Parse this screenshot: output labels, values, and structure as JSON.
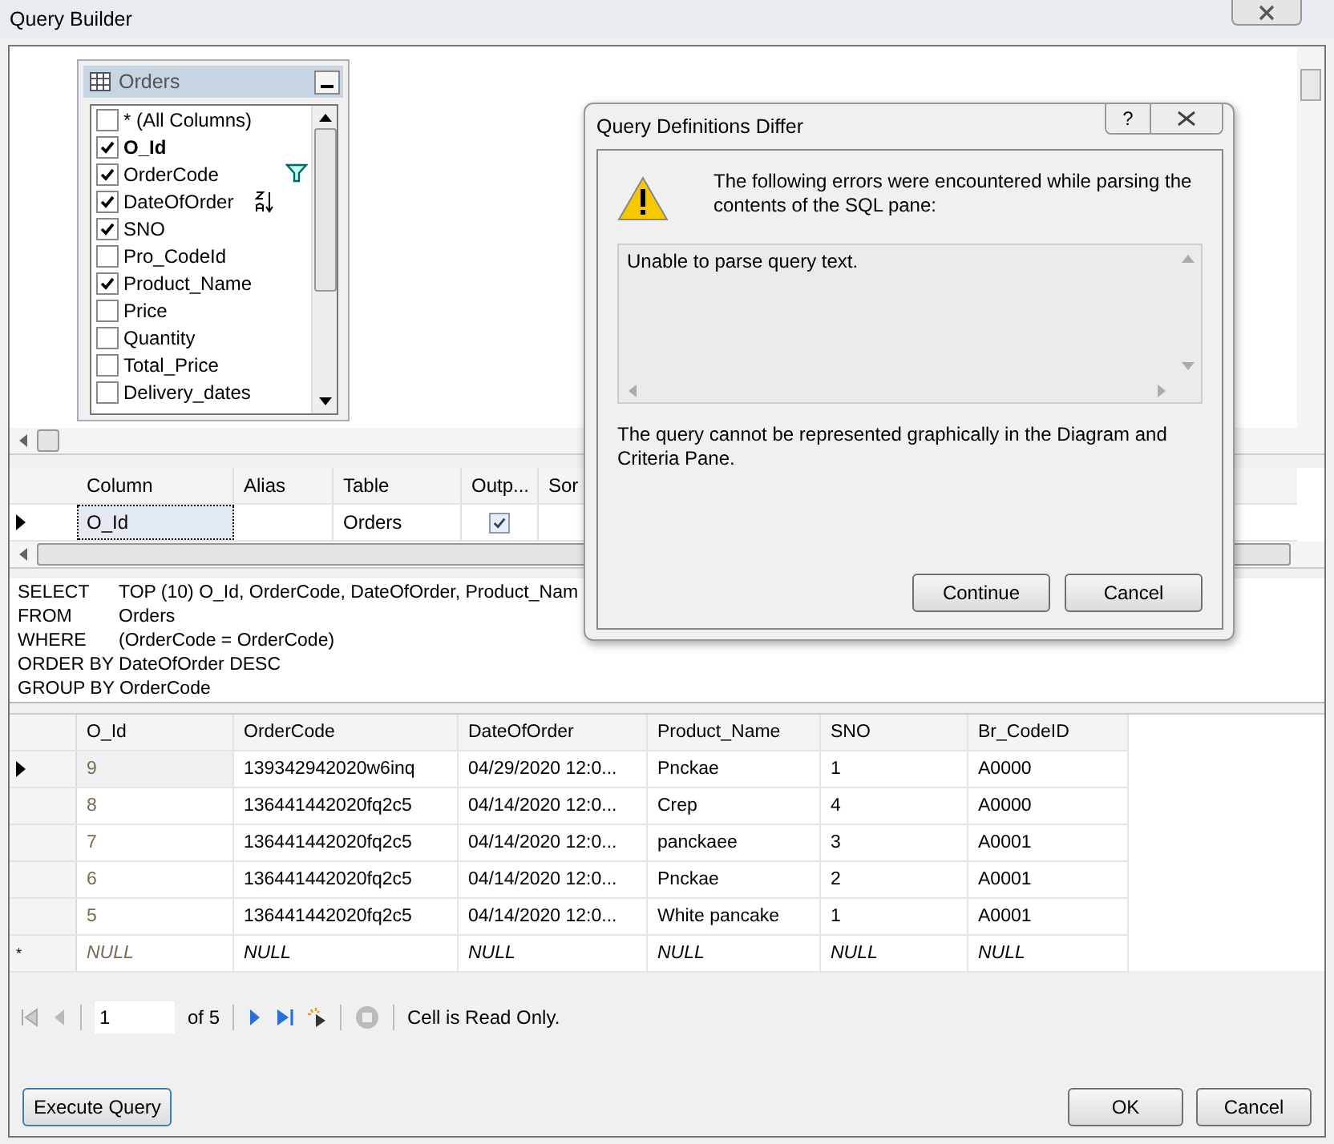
{
  "window": {
    "title": "Query Builder"
  },
  "diagram": {
    "table": {
      "title": "Orders",
      "columns": [
        {
          "name": "* (All Columns)",
          "checked": false,
          "key": false,
          "filtered": false,
          "sorted_desc": false
        },
        {
          "name": "O_Id",
          "checked": true,
          "key": true,
          "filtered": false,
          "sorted_desc": false
        },
        {
          "name": "OrderCode",
          "checked": true,
          "key": false,
          "filtered": true,
          "sorted_desc": false
        },
        {
          "name": "DateOfOrder",
          "checked": true,
          "key": false,
          "filtered": false,
          "sorted_desc": true
        },
        {
          "name": "SNO",
          "checked": true,
          "key": false,
          "filtered": false,
          "sorted_desc": false
        },
        {
          "name": "Pro_CodeId",
          "checked": false,
          "key": false,
          "filtered": false,
          "sorted_desc": false
        },
        {
          "name": "Product_Name",
          "checked": true,
          "key": false,
          "filtered": false,
          "sorted_desc": false
        },
        {
          "name": "Price",
          "checked": false,
          "key": false,
          "filtered": false,
          "sorted_desc": false
        },
        {
          "name": "Quantity",
          "checked": false,
          "key": false,
          "filtered": false,
          "sorted_desc": false
        },
        {
          "name": "Total_Price",
          "checked": false,
          "key": false,
          "filtered": false,
          "sorted_desc": false
        },
        {
          "name": "Delivery_dates",
          "checked": false,
          "key": false,
          "filtered": false,
          "sorted_desc": false
        }
      ]
    }
  },
  "criteria": {
    "columns": [
      "Column",
      "Alias",
      "Table",
      "Outp...",
      "Sor"
    ],
    "rows": [
      {
        "selected": true,
        "column": "O_Id",
        "alias": "",
        "table": "Orders",
        "output": true
      }
    ]
  },
  "sql": [
    [
      "SELECT",
      "TOP (10) O_Id, OrderCode, DateOfOrder, Product_Nam"
    ],
    [
      "FROM",
      "Orders"
    ],
    [
      "WHERE",
      "(OrderCode = OrderCode)"
    ],
    [
      "ORDER BY DateOfOrder DESC"
    ],
    [
      "GROUP BY  OrderCode"
    ]
  ],
  "results": {
    "columns": [
      "O_Id",
      "OrderCode",
      "DateOfOrder",
      "Product_Name",
      "SNO",
      "Br_CodeID"
    ],
    "rows": [
      {
        "selected": true,
        "cells": [
          "9",
          "139342942020w6inq",
          "04/29/2020 12:0...",
          "Pnckae",
          "1",
          "A0000"
        ]
      },
      {
        "selected": false,
        "cells": [
          "8",
          "136441442020fq2c5",
          "04/14/2020 12:0...",
          "Crep",
          "4",
          "A0000"
        ]
      },
      {
        "selected": false,
        "cells": [
          "7",
          "136441442020fq2c5",
          "04/14/2020 12:0...",
          "panckaee",
          "3",
          "A0001"
        ]
      },
      {
        "selected": false,
        "cells": [
          "6",
          "136441442020fq2c5",
          "04/14/2020 12:0...",
          "Pnckae",
          "2",
          "A0001"
        ]
      },
      {
        "selected": false,
        "cells": [
          "5",
          "136441442020fq2c5",
          "04/14/2020 12:0...",
          "White pancake",
          "1",
          "A0001"
        ]
      }
    ],
    "new_row": {
      "marker": "*",
      "cells": [
        "NULL",
        "NULL",
        "NULL",
        "NULL",
        "NULL",
        "NULL"
      ]
    }
  },
  "navigator": {
    "page": "1",
    "of": "of 5",
    "status": "Cell is Read Only."
  },
  "buttons": {
    "execute": "Execute Query",
    "ok": "OK",
    "cancel": "Cancel"
  },
  "dialog": {
    "title": "Query Definitions Differ",
    "help": "?",
    "message": "The following errors were encountered while parsing the contents of the SQL pane:",
    "details": "Unable to parse query text.",
    "note": "The query cannot be represented graphically in the Diagram and Criteria Pane.",
    "buttons": [
      "Continue",
      "Cancel"
    ]
  }
}
